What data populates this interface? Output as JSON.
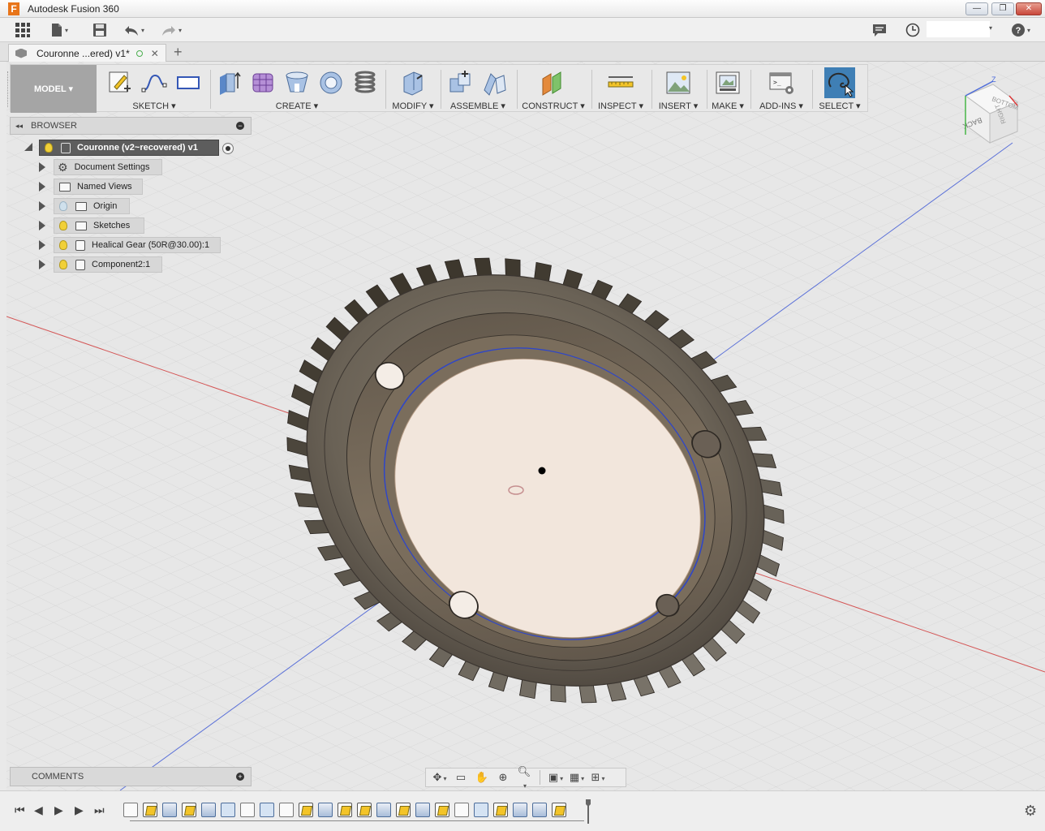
{
  "window": {
    "title": "Autodesk Fusion 360",
    "app_icon_letter": "F",
    "minimize": "—",
    "restore": "❐",
    "close": "✕"
  },
  "document_tab": {
    "label": "Couronne ...ered) v1*",
    "close": "✕",
    "new_tab": "+"
  },
  "toolbar": {
    "workspace": "MODEL ▾",
    "groups": [
      {
        "label": "SKETCH ▾"
      },
      {
        "label": "CREATE ▾"
      },
      {
        "label": "MODIFY ▾"
      },
      {
        "label": "ASSEMBLE ▾"
      },
      {
        "label": "CONSTRUCT ▾"
      },
      {
        "label": "INSPECT ▾"
      },
      {
        "label": "INSERT ▾"
      },
      {
        "label": "MAKE ▾"
      },
      {
        "label": "ADD-INS ▾"
      },
      {
        "label": "SELECT ▾"
      }
    ]
  },
  "browser": {
    "title": "BROWSER",
    "collapse": "◂◂",
    "minus": "−",
    "root": {
      "label": "Couronne (v2~recovered) v1"
    },
    "items": [
      {
        "label": "Document Settings",
        "icon": "gear-icon",
        "light": false
      },
      {
        "label": "Named Views",
        "icon": "folder-icon",
        "light": false
      },
      {
        "label": "Origin",
        "icon": "folder-icon",
        "light": "off"
      },
      {
        "label": "Sketches",
        "icon": "folder-icon",
        "light": "on"
      },
      {
        "label": "Healical Gear (50R@30.00):1",
        "icon": "component-icon",
        "light": "on"
      },
      {
        "label": "Component2:1",
        "icon": "component-icon",
        "light": "on"
      }
    ]
  },
  "viewcube": {
    "back": "BACK",
    "bottom": "BOTTOM",
    "right": "RIGHT",
    "axis_z": "Z"
  },
  "comments": {
    "title": "COMMENTS",
    "plus": "+"
  },
  "navbar": {
    "icons": [
      "orbit-icon",
      "look-at-icon",
      "pan-icon",
      "zoom-window-icon",
      "zoom-icon",
      "display-settings-icon",
      "grid-settings-icon",
      "viewports-icon"
    ]
  },
  "timeline": {
    "controls": [
      "⏮",
      "◀",
      "▶",
      "▶",
      "⏭"
    ],
    "features": [
      "body",
      "sketch",
      "extrude",
      "sketch",
      "revolve",
      "move",
      "body",
      "mirror",
      "body",
      "sketch",
      "extrude",
      "sketch",
      "sketch",
      "extrude",
      "sketch",
      "extrude",
      "sketch",
      "body",
      "move",
      "sketch",
      "extrude",
      "extrude",
      "sketch"
    ],
    "settings": "⚙"
  },
  "colors": {
    "accent_select": "#3f7fb5",
    "gear_body": "#6a6256",
    "face_fill": "#f2e6dc",
    "grid": "#d6d6d6",
    "axis_red": "#d23b3b",
    "axis_blue": "#3b55d2"
  }
}
